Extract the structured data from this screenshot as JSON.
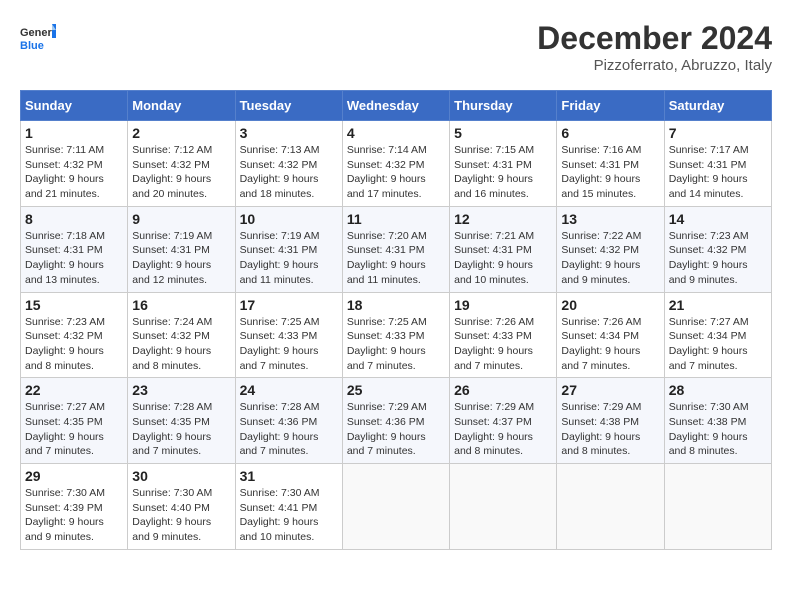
{
  "header": {
    "logo_line1": "General",
    "logo_line2": "Blue",
    "month_title": "December 2024",
    "subtitle": "Pizzoferrato, Abruzzo, Italy"
  },
  "calendar": {
    "days_of_week": [
      "Sunday",
      "Monday",
      "Tuesday",
      "Wednesday",
      "Thursday",
      "Friday",
      "Saturday"
    ],
    "weeks": [
      [
        {
          "day": "1",
          "sunrise": "Sunrise: 7:11 AM",
          "sunset": "Sunset: 4:32 PM",
          "daylight": "Daylight: 9 hours and 21 minutes."
        },
        {
          "day": "2",
          "sunrise": "Sunrise: 7:12 AM",
          "sunset": "Sunset: 4:32 PM",
          "daylight": "Daylight: 9 hours and 20 minutes."
        },
        {
          "day": "3",
          "sunrise": "Sunrise: 7:13 AM",
          "sunset": "Sunset: 4:32 PM",
          "daylight": "Daylight: 9 hours and 18 minutes."
        },
        {
          "day": "4",
          "sunrise": "Sunrise: 7:14 AM",
          "sunset": "Sunset: 4:32 PM",
          "daylight": "Daylight: 9 hours and 17 minutes."
        },
        {
          "day": "5",
          "sunrise": "Sunrise: 7:15 AM",
          "sunset": "Sunset: 4:31 PM",
          "daylight": "Daylight: 9 hours and 16 minutes."
        },
        {
          "day": "6",
          "sunrise": "Sunrise: 7:16 AM",
          "sunset": "Sunset: 4:31 PM",
          "daylight": "Daylight: 9 hours and 15 minutes."
        },
        {
          "day": "7",
          "sunrise": "Sunrise: 7:17 AM",
          "sunset": "Sunset: 4:31 PM",
          "daylight": "Daylight: 9 hours and 14 minutes."
        }
      ],
      [
        {
          "day": "8",
          "sunrise": "Sunrise: 7:18 AM",
          "sunset": "Sunset: 4:31 PM",
          "daylight": "Daylight: 9 hours and 13 minutes."
        },
        {
          "day": "9",
          "sunrise": "Sunrise: 7:19 AM",
          "sunset": "Sunset: 4:31 PM",
          "daylight": "Daylight: 9 hours and 12 minutes."
        },
        {
          "day": "10",
          "sunrise": "Sunrise: 7:19 AM",
          "sunset": "Sunset: 4:31 PM",
          "daylight": "Daylight: 9 hours and 11 minutes."
        },
        {
          "day": "11",
          "sunrise": "Sunrise: 7:20 AM",
          "sunset": "Sunset: 4:31 PM",
          "daylight": "Daylight: 9 hours and 11 minutes."
        },
        {
          "day": "12",
          "sunrise": "Sunrise: 7:21 AM",
          "sunset": "Sunset: 4:31 PM",
          "daylight": "Daylight: 9 hours and 10 minutes."
        },
        {
          "day": "13",
          "sunrise": "Sunrise: 7:22 AM",
          "sunset": "Sunset: 4:32 PM",
          "daylight": "Daylight: 9 hours and 9 minutes."
        },
        {
          "day": "14",
          "sunrise": "Sunrise: 7:23 AM",
          "sunset": "Sunset: 4:32 PM",
          "daylight": "Daylight: 9 hours and 9 minutes."
        }
      ],
      [
        {
          "day": "15",
          "sunrise": "Sunrise: 7:23 AM",
          "sunset": "Sunset: 4:32 PM",
          "daylight": "Daylight: 9 hours and 8 minutes."
        },
        {
          "day": "16",
          "sunrise": "Sunrise: 7:24 AM",
          "sunset": "Sunset: 4:32 PM",
          "daylight": "Daylight: 9 hours and 8 minutes."
        },
        {
          "day": "17",
          "sunrise": "Sunrise: 7:25 AM",
          "sunset": "Sunset: 4:33 PM",
          "daylight": "Daylight: 9 hours and 7 minutes."
        },
        {
          "day": "18",
          "sunrise": "Sunrise: 7:25 AM",
          "sunset": "Sunset: 4:33 PM",
          "daylight": "Daylight: 9 hours and 7 minutes."
        },
        {
          "day": "19",
          "sunrise": "Sunrise: 7:26 AM",
          "sunset": "Sunset: 4:33 PM",
          "daylight": "Daylight: 9 hours and 7 minutes."
        },
        {
          "day": "20",
          "sunrise": "Sunrise: 7:26 AM",
          "sunset": "Sunset: 4:34 PM",
          "daylight": "Daylight: 9 hours and 7 minutes."
        },
        {
          "day": "21",
          "sunrise": "Sunrise: 7:27 AM",
          "sunset": "Sunset: 4:34 PM",
          "daylight": "Daylight: 9 hours and 7 minutes."
        }
      ],
      [
        {
          "day": "22",
          "sunrise": "Sunrise: 7:27 AM",
          "sunset": "Sunset: 4:35 PM",
          "daylight": "Daylight: 9 hours and 7 minutes."
        },
        {
          "day": "23",
          "sunrise": "Sunrise: 7:28 AM",
          "sunset": "Sunset: 4:35 PM",
          "daylight": "Daylight: 9 hours and 7 minutes."
        },
        {
          "day": "24",
          "sunrise": "Sunrise: 7:28 AM",
          "sunset": "Sunset: 4:36 PM",
          "daylight": "Daylight: 9 hours and 7 minutes."
        },
        {
          "day": "25",
          "sunrise": "Sunrise: 7:29 AM",
          "sunset": "Sunset: 4:36 PM",
          "daylight": "Daylight: 9 hours and 7 minutes."
        },
        {
          "day": "26",
          "sunrise": "Sunrise: 7:29 AM",
          "sunset": "Sunset: 4:37 PM",
          "daylight": "Daylight: 9 hours and 8 minutes."
        },
        {
          "day": "27",
          "sunrise": "Sunrise: 7:29 AM",
          "sunset": "Sunset: 4:38 PM",
          "daylight": "Daylight: 9 hours and 8 minutes."
        },
        {
          "day": "28",
          "sunrise": "Sunrise: 7:30 AM",
          "sunset": "Sunset: 4:38 PM",
          "daylight": "Daylight: 9 hours and 8 minutes."
        }
      ],
      [
        {
          "day": "29",
          "sunrise": "Sunrise: 7:30 AM",
          "sunset": "Sunset: 4:39 PM",
          "daylight": "Daylight: 9 hours and 9 minutes."
        },
        {
          "day": "30",
          "sunrise": "Sunrise: 7:30 AM",
          "sunset": "Sunset: 4:40 PM",
          "daylight": "Daylight: 9 hours and 9 minutes."
        },
        {
          "day": "31",
          "sunrise": "Sunrise: 7:30 AM",
          "sunset": "Sunset: 4:41 PM",
          "daylight": "Daylight: 9 hours and 10 minutes."
        },
        null,
        null,
        null,
        null
      ]
    ]
  }
}
